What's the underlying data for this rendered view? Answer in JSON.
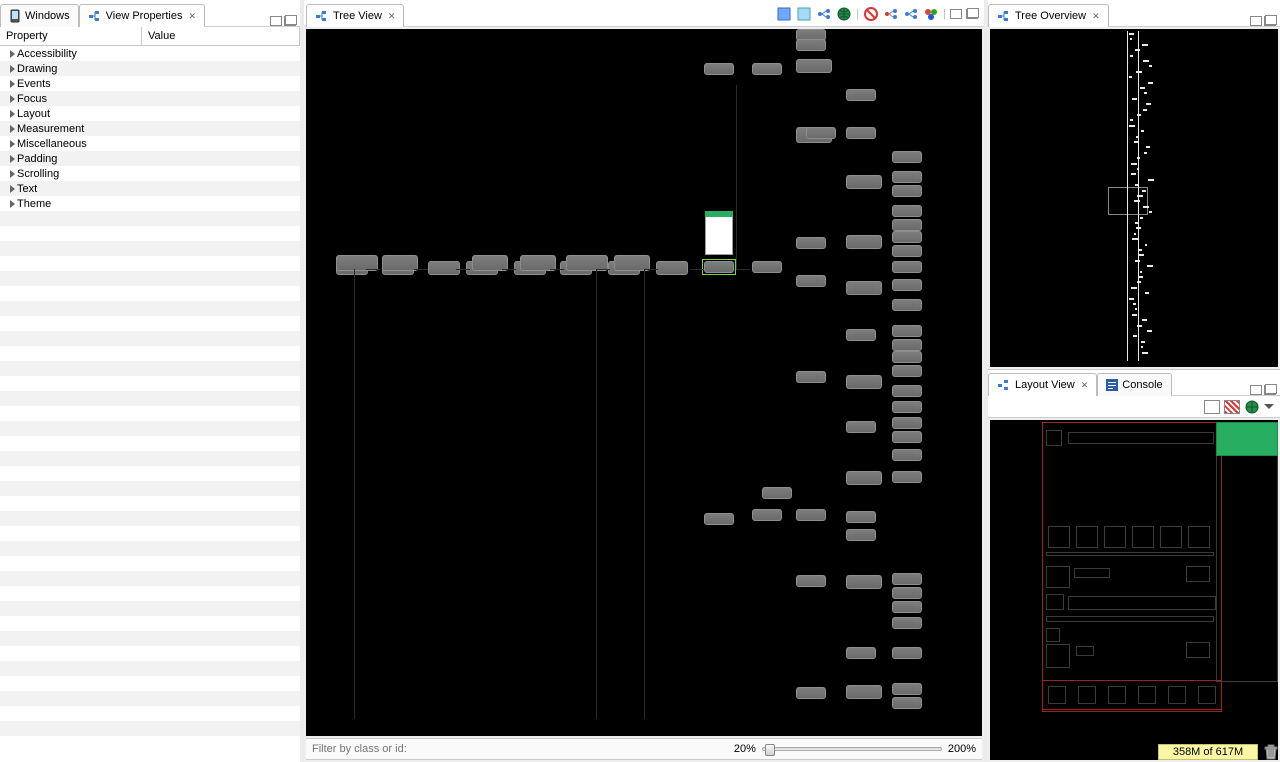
{
  "left": {
    "tabs": {
      "windows": "Windows",
      "view_props": "View Properties"
    },
    "columns": {
      "property": "Property",
      "value": "Value"
    },
    "props": [
      "Accessibility",
      "Drawing",
      "Events",
      "Focus",
      "Layout",
      "Measurement",
      "Miscellaneous",
      "Padding",
      "Scrolling",
      "Text",
      "Theme"
    ]
  },
  "center": {
    "tab": "Tree View",
    "filter_placeholder": "Filter by class or id:",
    "zoom_min": "20%",
    "zoom_max": "200%"
  },
  "right": {
    "overview_tab": "Tree Overview",
    "layout_tab": "Layout View",
    "console_tab": "Console"
  },
  "status": {
    "mem": "358M of 617M"
  },
  "icons": {
    "windows": "windows-icon",
    "tree": "tree-icon",
    "close": "close-icon",
    "minimize": "minimize-icon",
    "maximize": "maximize-icon",
    "console": "console-icon",
    "globe": "globe-icon"
  }
}
